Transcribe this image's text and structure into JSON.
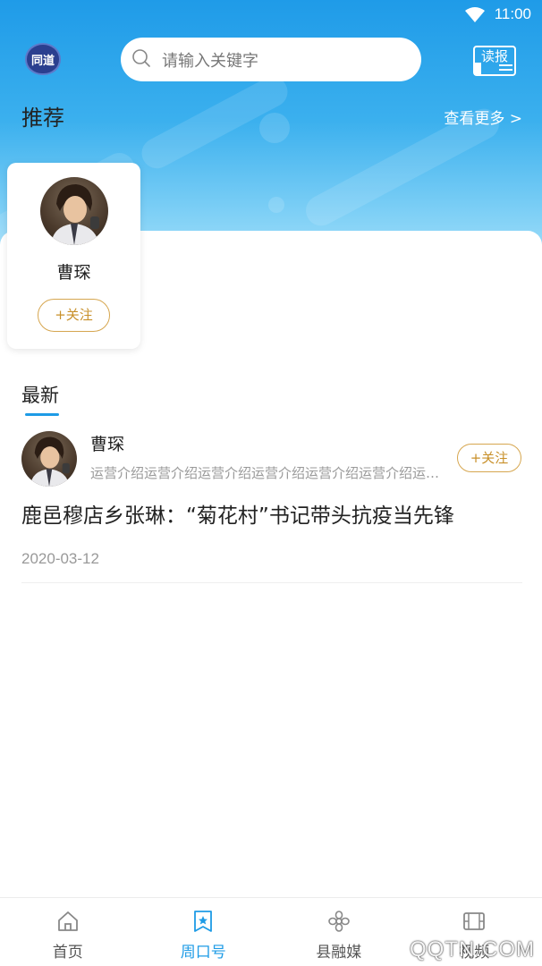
{
  "status_bar": {
    "time": "11:00"
  },
  "header": {
    "logo_text": "同道",
    "search_placeholder": "请输入关键字",
    "read_button_label": "读报"
  },
  "recommend": {
    "title": "推荐",
    "more_link": "查看更多 >",
    "items": [
      {
        "name": "曹琛",
        "follow_label": "+关注"
      }
    ]
  },
  "latest": {
    "title": "最新",
    "posts": [
      {
        "author": "曹琛",
        "description": "运营介绍运营介绍运营介绍运营介绍运营介绍运营介绍运营介绍",
        "follow_label": "+关注",
        "headline": "鹿邑穆店乡张琳：“菊花村”书记带头抗疫当先锋",
        "date": "2020-03-12"
      }
    ]
  },
  "tabs": [
    {
      "label": "首页",
      "icon": "home-icon",
      "active": false
    },
    {
      "label": "周口号",
      "icon": "bookmark-star-icon",
      "active": true
    },
    {
      "label": "县融媒",
      "icon": "flower-icon",
      "active": false
    },
    {
      "label": "视频",
      "icon": "film-icon",
      "active": false
    }
  ],
  "watermark": "QQTN.COM",
  "colors": {
    "accent": "#1e9be6",
    "follow": "#c8902a",
    "header_top": "#1f9be8"
  }
}
